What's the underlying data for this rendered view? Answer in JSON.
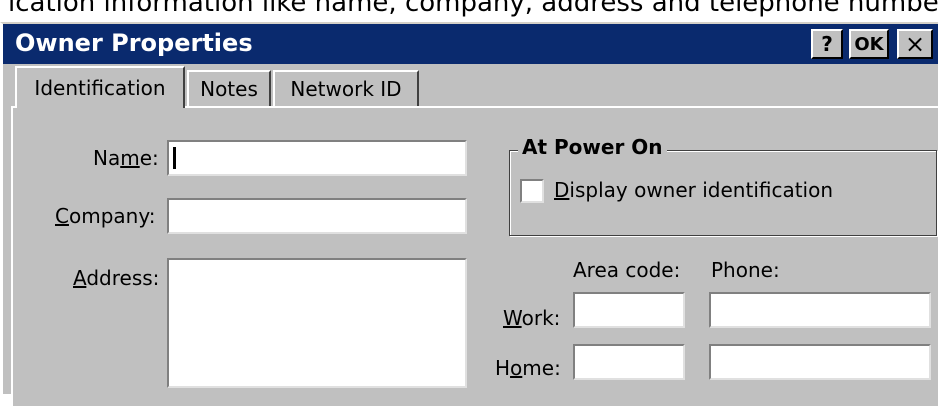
{
  "top_strip_text": "ication information like name, company, address and telephone numbers.",
  "window": {
    "title": "Owner Properties",
    "help_button": "?",
    "ok_button": "OK",
    "close_button": "×"
  },
  "tabs": [
    {
      "label": "Identification",
      "active": true
    },
    {
      "label": "Notes",
      "active": false
    },
    {
      "label": "Network ID",
      "active": false
    }
  ],
  "form": {
    "name": {
      "pre": "Na",
      "mn": "m",
      "post": "e:",
      "value": ""
    },
    "company": {
      "mn": "C",
      "post": "ompany:",
      "value": ""
    },
    "address": {
      "mn": "A",
      "post": "ddress:",
      "value": ""
    }
  },
  "power_on": {
    "group_title": "At Power On",
    "checkbox_mn": "D",
    "checkbox_post": "isplay owner identification",
    "checked": false
  },
  "phone": {
    "area_code_header": "Area code:",
    "phone_header": "Phone:",
    "work": {
      "mn": "W",
      "post": "ork:",
      "area_code": "",
      "number": ""
    },
    "home": {
      "pre": "H",
      "mn": "o",
      "post": "me:",
      "area_code": "",
      "number": ""
    }
  },
  "colors": {
    "titlebar": "#0a2a6e",
    "face": "#c0c0c0"
  }
}
